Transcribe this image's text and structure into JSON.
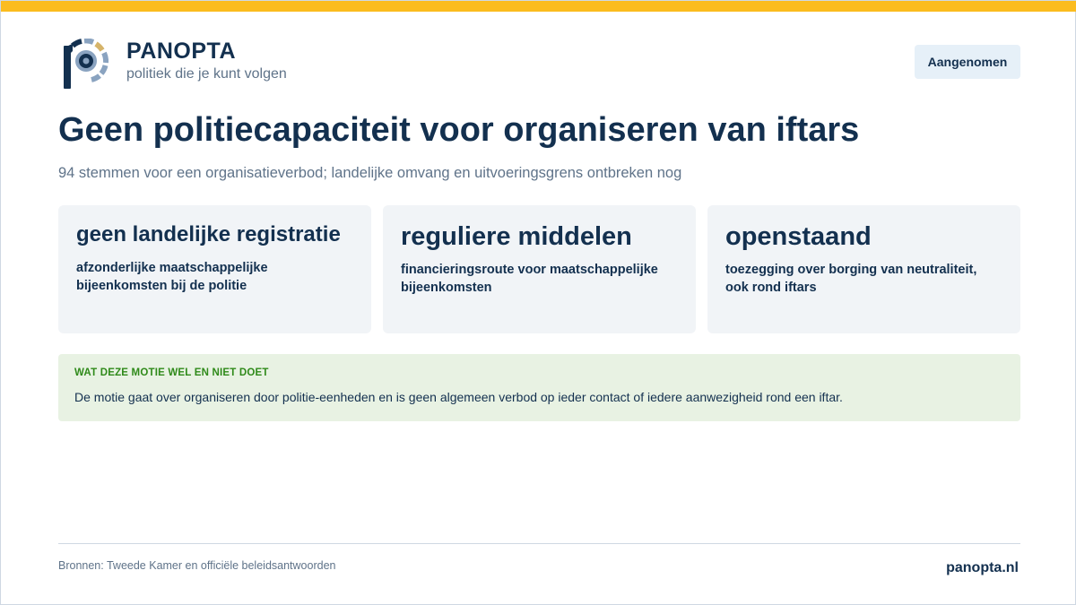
{
  "brand": {
    "name": "PANOPTA",
    "tagline": "politiek die je kunt volgen",
    "logo_icon": "panopta-eye-logo-icon"
  },
  "status": {
    "label": "Aangenomen"
  },
  "headline": {
    "title": "Geen politiecapaciteit voor organiseren van iftars",
    "subtitle": "94 stemmen voor een organisatieverbod; landelijke omvang en uitvoeringsgrens ontbreken nog"
  },
  "cards": [
    {
      "heading": "geen landelijke registratie",
      "body": "afzonderlijke maatschappelijke bijeenkomsten bij de politie"
    },
    {
      "heading": "reguliere middelen",
      "body": "financieringsroute voor maatschappelijke bijeenkomsten"
    },
    {
      "heading": "openstaand",
      "body": "toezegging over borging van neutraliteit, ook rond iftars"
    }
  ],
  "note": {
    "label": "WAT DEZE MOTIE WEL EN NIET DOET",
    "text": "De motie gaat over organiseren door politie-eenheden en is geen algemeen verbod op ieder contact of iedere aanwezigheid rond een iftar."
  },
  "footer": {
    "sources": "Bronnen: Tweede Kamer en officiële beleidsantwoorden",
    "domain": "panopta.nl"
  },
  "colors": {
    "accent_bar": "#fbbc1f",
    "navy": "#13304f",
    "muted": "#5f7389",
    "card_bg": "#f1f4f7",
    "note_bg": "#e8f2e3",
    "note_label": "#2f8a1a",
    "status_bg": "#e6f0f8"
  }
}
